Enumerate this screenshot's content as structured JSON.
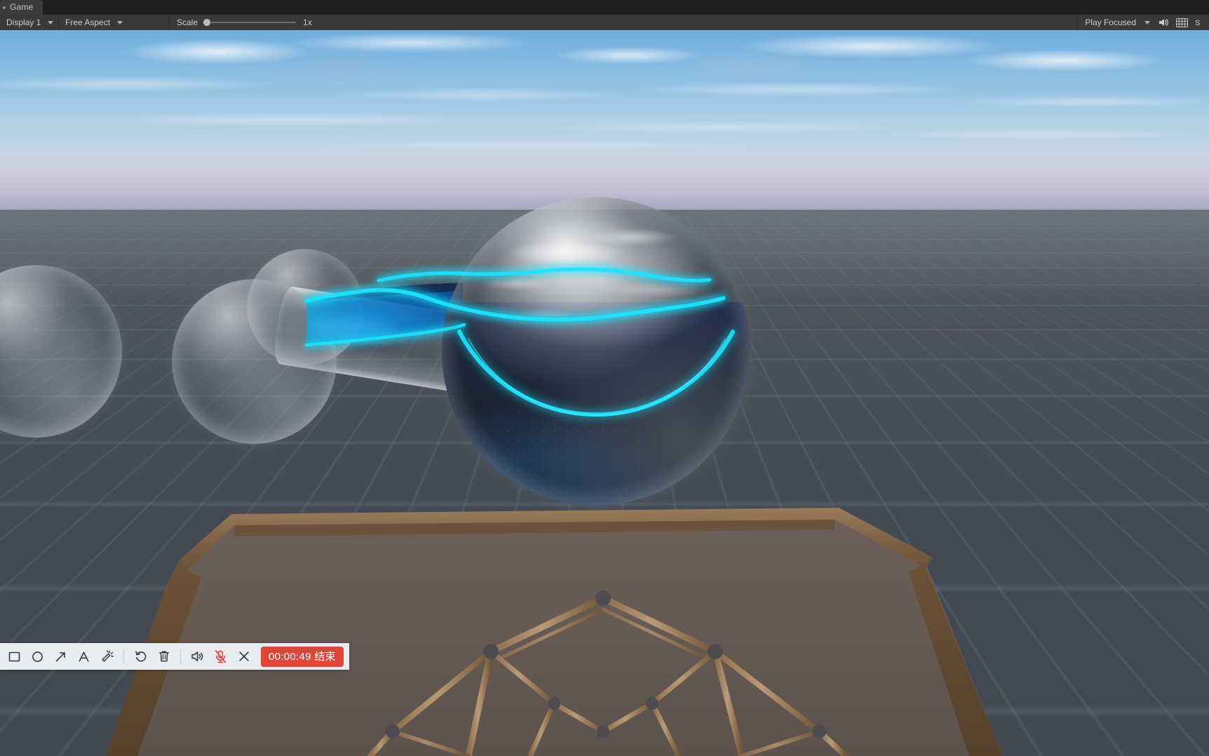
{
  "window": {
    "tab_label": "Game"
  },
  "toolbar": {
    "display_label": "Display 1",
    "aspect_label": "Free Aspect",
    "scale_label": "Scale",
    "scale_value": "1x",
    "playmode_label": "Play Focused",
    "mute_audio_icon": "speaker-icon",
    "stats_icon": "stats-grid-icon",
    "gizmos_icon": "gizmos-icon"
  },
  "recorder": {
    "tools": [
      {
        "name": "rectangle-tool",
        "icon": "rectangle-icon"
      },
      {
        "name": "ellipse-tool",
        "icon": "circle-icon"
      },
      {
        "name": "arrow-tool",
        "icon": "arrow-icon"
      },
      {
        "name": "text-tool",
        "icon": "text-a-icon",
        "glyph": "A"
      },
      {
        "name": "highlighter-tool",
        "icon": "magic-wand-icon"
      }
    ],
    "undo_icon": "undo-icon",
    "delete_icon": "trash-icon",
    "speaker_icon": "speaker-icon",
    "mic_icon": "microphone-muted-icon",
    "close_icon": "close-x-icon",
    "end_label": "00:00:49 结束",
    "accent_red": "#e0453c",
    "mic_muted_color": "#e0453c",
    "panel_bg": "#e9edf2"
  },
  "scene": {
    "description": "Unity game view: glass spheres connected by a glass tube, filled with dark liquid and a glowing cyan surface line, above a grid ground plane with a wooden hexagonal platform and geodesic dome frame",
    "liquid_glow_color": "#1fe3ff",
    "liquid_deep_color": "#020a20",
    "sky_top_color": "#72aede",
    "horizon_color": "#b0aec8",
    "ground_color": "#474d56",
    "wood_color": "#7a5c42"
  }
}
